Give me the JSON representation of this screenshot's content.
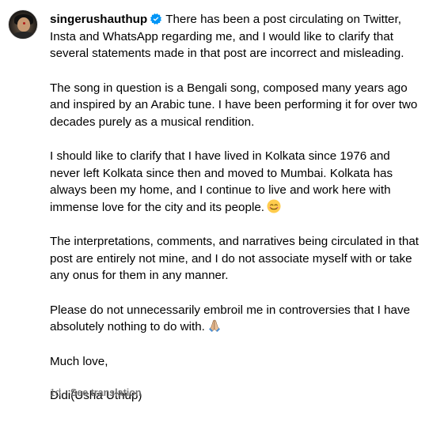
{
  "post": {
    "username": "singerushauthup",
    "verified_icon": "verified-badge-icon",
    "paragraphs": [
      "There has been a post circulating on Twitter, Insta and WhatsApp regarding me, and I would like to clarify that several statements made in that post are incorrect and misleading.",
      "The song in question is a Bengali song, composed many years ago and inspired by an Arabic tune. I have been performing it for over two decades purely as a musical rendition.",
      "I should like to clarify that I have lived in Kolkata since 1976 and never left Kolkata since then and moved to Mumbai. Kolkata has always been my home, and I continue to live and work here with immense love for the city and its people.",
      "The interpretations, comments, and narratives being circulated in that post are entirely not mine, and I do not associate myself with or take any onus for them in any manner.",
      "Please do not unnecessarily embroil me in controversies that I have absolutely nothing to do with.",
      "Much love,",
      "Didi(Usha Uthup)"
    ],
    "emojis": {
      "smile": "smiling-face-icon",
      "pray": "folded-hands-icon"
    },
    "timestamp": "1d",
    "see_translation_label": "See translation"
  },
  "colors": {
    "verified_blue": "#0095f6",
    "meta_gray": "#737373",
    "text": "#000000"
  }
}
